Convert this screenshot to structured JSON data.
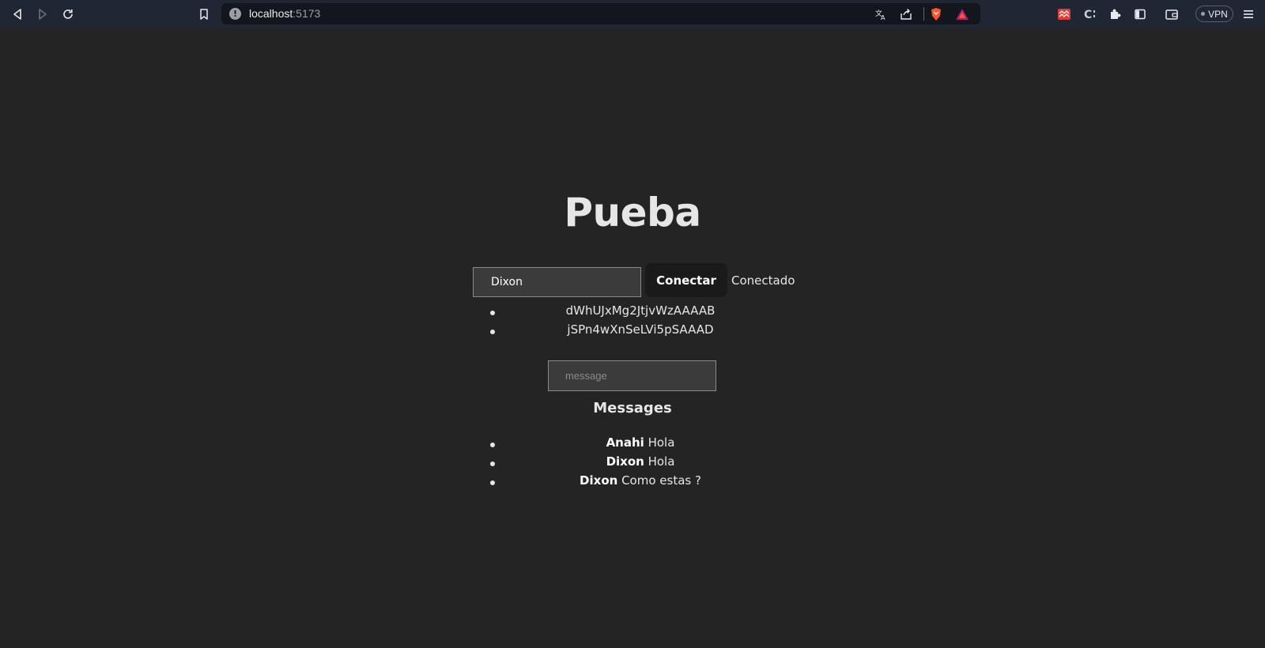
{
  "browser": {
    "url_host": "localhost",
    "url_port": ":5173",
    "vpn_label": "VPN"
  },
  "page": {
    "title": "Pueba",
    "name_input_value": "Dixon",
    "connect_label": "Conectar",
    "status": "Conectado",
    "users": [
      "dWhUJxMg2JtjvWzAAAAB",
      "jSPn4wXnSeLVi5pSAAAD"
    ],
    "message_placeholder": "message",
    "messages_heading": "Messages",
    "messages": [
      {
        "author": "Anahi",
        "text": " Hola"
      },
      {
        "author": "Dixon",
        "text": " Hola"
      },
      {
        "author": "Dixon",
        "text": " Como estas ?"
      }
    ]
  },
  "colors": {
    "page_background": "#242424",
    "chrome_background": "#202633",
    "button_background": "#1a1a1a",
    "input_background": "#3b3b3b"
  }
}
